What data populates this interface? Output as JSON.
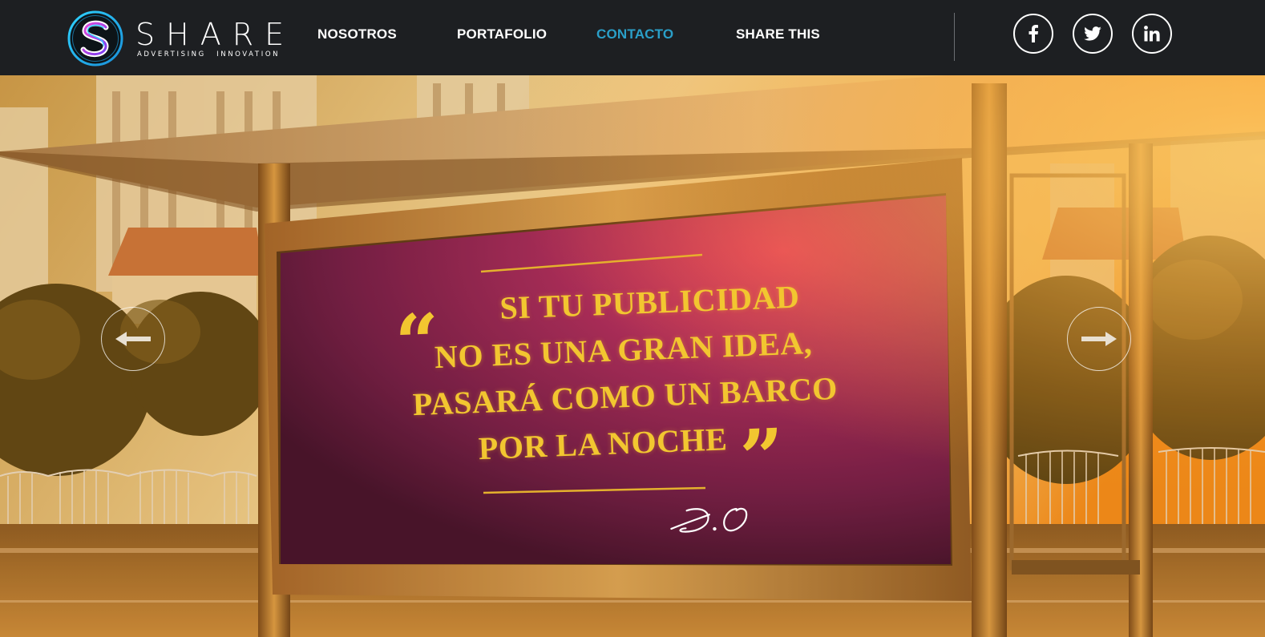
{
  "brand": {
    "name": "SHARE",
    "tagline": "ADVERTISING INNOVATION",
    "logo_letter": "S",
    "colors": {
      "ring_outer": "#27b7e5",
      "ring_inner": "#c23bd9"
    }
  },
  "nav": {
    "items": [
      {
        "label": "NOSOTROS",
        "active": false
      },
      {
        "label": "PORTAFOLIO",
        "active": false
      },
      {
        "label": "CONTACTO",
        "active": true
      },
      {
        "label": "SHARE THIS",
        "active": false
      }
    ],
    "active_color": "#2a9fc8"
  },
  "social": [
    {
      "icon": "facebook-icon",
      "label": "f"
    },
    {
      "icon": "twitter-icon",
      "label": ""
    },
    {
      "icon": "linkedin-icon",
      "label": "in"
    }
  ],
  "hero": {
    "quote_lines": [
      "SI TU PUBLICIDAD",
      "NO ES UNA GRAN IDEA,",
      "PASARÁ COMO UN BARCO",
      "POR LA NOCHE"
    ],
    "quote_open": "“",
    "quote_close": "”",
    "signature": "D.O",
    "prev_icon": "arrow-left-icon",
    "next_icon": "arrow-right-icon"
  }
}
